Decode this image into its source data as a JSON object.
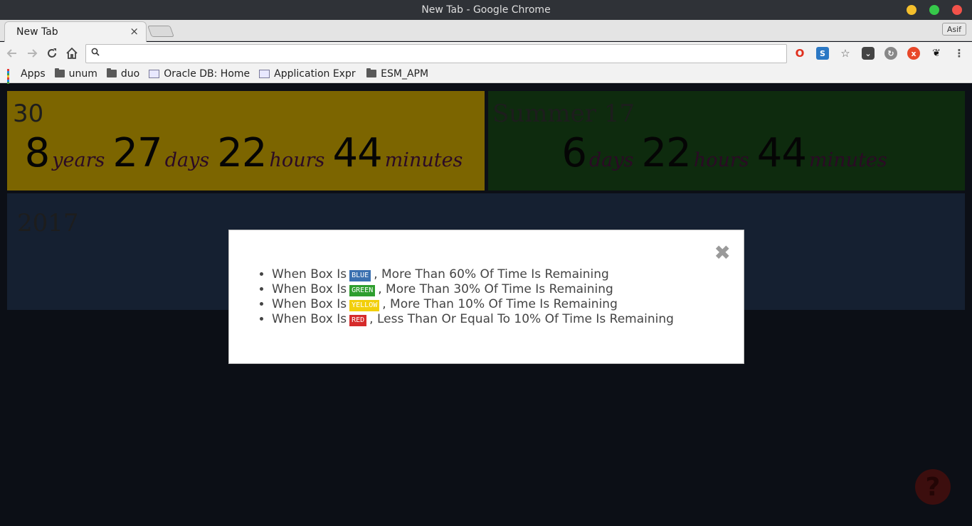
{
  "window": {
    "title": "New Tab - Google Chrome"
  },
  "tabs": [
    {
      "label": "New Tab",
      "close": "×"
    }
  ],
  "profile": {
    "name": "Asif"
  },
  "omnibox": {
    "value": "",
    "placeholder": ""
  },
  "bookmarks": [
    {
      "label": "Apps",
      "icon": "apps-grid-icon"
    },
    {
      "label": "unum",
      "icon": "folder-icon"
    },
    {
      "label": "duo",
      "icon": "folder-icon"
    },
    {
      "label": "Oracle DB: Home",
      "icon": "page-icon"
    },
    {
      "label": "Application Expr",
      "icon": "page-icon"
    },
    {
      "label": "ESM_APM",
      "icon": "folder-icon"
    }
  ],
  "boxes": [
    {
      "title": "30",
      "color": "#7c6500",
      "units": [
        {
          "num": "8",
          "label": "years"
        },
        {
          "num": "27",
          "label": "days"
        },
        {
          "num": "22",
          "label": "hours"
        },
        {
          "num": "44",
          "label": "minutes"
        }
      ]
    },
    {
      "title": "Summer 17",
      "color": "#0e2b0e",
      "units": [
        {
          "num": "6",
          "label": "days"
        },
        {
          "num": "22",
          "label": "hours"
        },
        {
          "num": "44",
          "label": "minutes"
        }
      ]
    },
    {
      "title": "2017",
      "color": "#152031",
      "units": []
    }
  ],
  "modal": {
    "close": "✖",
    "items": [
      {
        "prefix": "When Box Is",
        "badge": "BLUE",
        "badge_color": "#3a70b0",
        "suffix": ", More Than 60% Of Time Is Remaining"
      },
      {
        "prefix": "When Box Is",
        "badge": "GREEN",
        "badge_color": "#2e9e2e",
        "suffix": ", More Than 30% Of Time Is Remaining"
      },
      {
        "prefix": "When Box Is",
        "badge": "YELLOW",
        "badge_color": "#f2cf0a",
        "suffix": ", More Than 10% Of Time Is Remaining"
      },
      {
        "prefix": "When Box Is",
        "badge": "RED",
        "badge_color": "#d62b2b",
        "suffix": ", Less Than Or Equal To 10% Of Time Is Remaining"
      }
    ]
  },
  "help": {
    "label": "?"
  }
}
